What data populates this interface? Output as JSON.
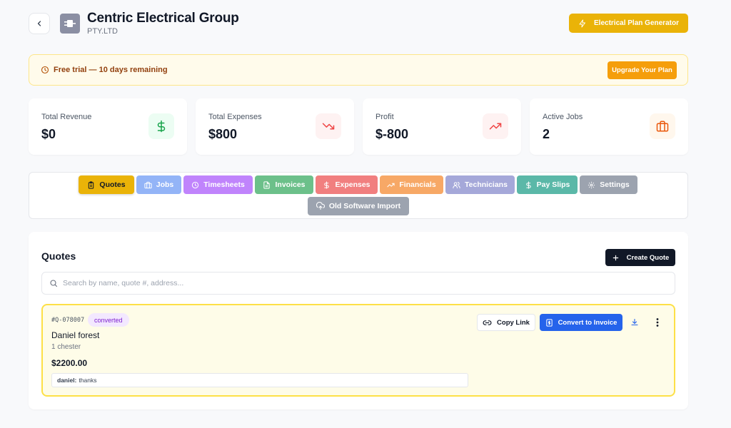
{
  "header": {
    "company_name": "Centric Electrical Group",
    "company_sub": "PTY.LTD",
    "plan_generator_label": "Electrical Plan Generator"
  },
  "trial_banner": {
    "text": "Free trial — 10 days remaining",
    "upgrade_label": "Upgrade Your Plan"
  },
  "stats": [
    {
      "label": "Total Revenue",
      "value": "$0",
      "icon": "dollar-icon",
      "color": "#16a34a"
    },
    {
      "label": "Total Expenses",
      "value": "$800",
      "icon": "trending-down-icon",
      "color": "#ef4444"
    },
    {
      "label": "Profit",
      "value": "$-800",
      "icon": "trending-up-icon",
      "color": "#ef4444"
    },
    {
      "label": "Active Jobs",
      "value": "2",
      "icon": "briefcase-icon",
      "color": "#ea580c"
    }
  ],
  "tabs": [
    {
      "label": "Quotes",
      "icon": "clipboard-icon",
      "color": "#eab308",
      "active": true
    },
    {
      "label": "Jobs",
      "icon": "briefcase-icon",
      "color": "#93b4f7"
    },
    {
      "label": "Timesheets",
      "icon": "clock-icon",
      "color": "#c084fc"
    },
    {
      "label": "Invoices",
      "icon": "document-icon",
      "color": "#6cc08a"
    },
    {
      "label": "Expenses",
      "icon": "dollar-icon",
      "color": "#f17f7f"
    },
    {
      "label": "Financials",
      "icon": "trending-up-icon",
      "color": "#f7a866"
    },
    {
      "label": "Technicians",
      "icon": "users-icon",
      "color": "#a5a8d9"
    },
    {
      "label": "Pay Slips",
      "icon": "dollar-icon",
      "color": "#5bb8a8"
    },
    {
      "label": "Settings",
      "icon": "gear-icon",
      "color": "#9ca3af"
    },
    {
      "label": "Old Software Import",
      "icon": "upload-icon",
      "color": "#9ca3af"
    }
  ],
  "quotes": {
    "title": "Quotes",
    "create_label": "Create Quote",
    "search_placeholder": "Search by name, quote #, address...",
    "items": [
      {
        "number": "#Q-078007",
        "status": "converted",
        "client": "Daniel forest",
        "address": "1 chester",
        "amount": "$2200.00",
        "note_author": "daniel:",
        "note_text": "thanks",
        "copy_label": "Copy Link",
        "convert_label": "Convert to Invoice"
      }
    ]
  }
}
